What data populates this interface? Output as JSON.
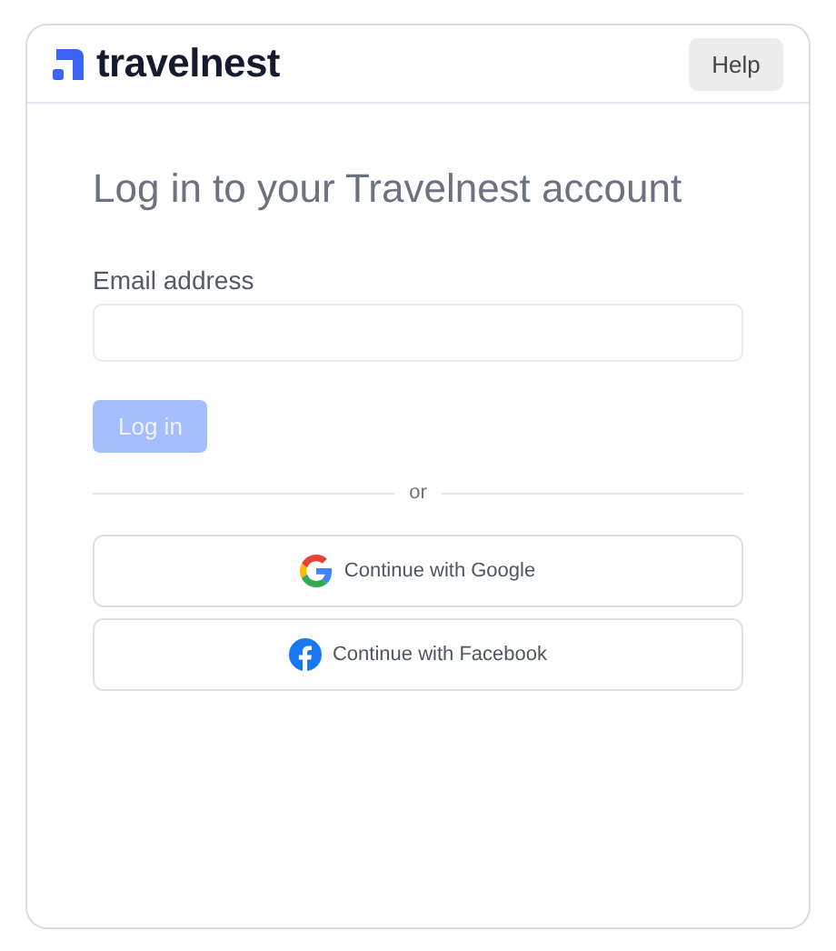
{
  "header": {
    "brand": "travelnest",
    "help_button": "Help"
  },
  "title": "Log in to your Travelnest account",
  "email": {
    "label": "Email address"
  },
  "login_button": {
    "label": "Log in",
    "disabled": true
  },
  "divider": "or",
  "providers": [
    {
      "kind": "google",
      "label": "Continue with Google"
    },
    {
      "kind": "facebook",
      "label": "Continue with Facebook"
    }
  ]
}
